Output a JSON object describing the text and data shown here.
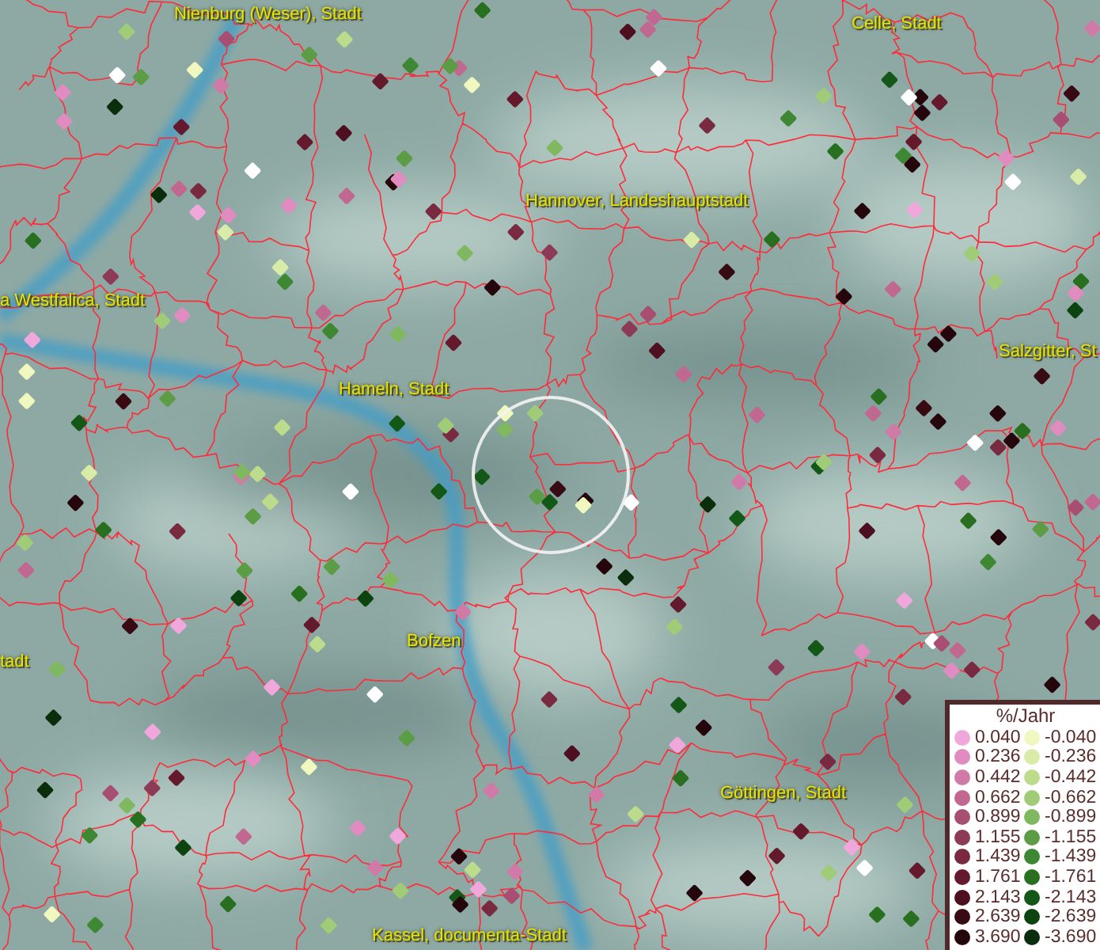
{
  "places": [
    {
      "name": "Nienburg (Weser), Stadt"
    },
    {
      "name": "Celle, Stadt"
    },
    {
      "name": "Hannover, Landeshauptstadt"
    },
    {
      "name": "a Westfalica, Stadt"
    },
    {
      "name": "Hameln, Stadt"
    },
    {
      "name": "Salzgitter, St"
    },
    {
      "name": "tadt"
    },
    {
      "name": "Bofzen"
    },
    {
      "name": "Göttingen, Stadt"
    },
    {
      "name": "Kassel, documenta-Stadt"
    }
  ],
  "legend": {
    "title": "%/Jahr",
    "positive": [
      {
        "label": "0.040",
        "color": "#f0a8dc"
      },
      {
        "label": "0.236",
        "color": "#e08cc0"
      },
      {
        "label": "0.442",
        "color": "#d07aa8"
      },
      {
        "label": "0.662",
        "color": "#c06890"
      },
      {
        "label": "0.899",
        "color": "#a84e72"
      },
      {
        "label": "1.155",
        "color": "#8c3a55"
      },
      {
        "label": "1.439",
        "color": "#7a2a40"
      },
      {
        "label": "1.761",
        "color": "#641a2c"
      },
      {
        "label": "2.143",
        "color": "#4e1020"
      },
      {
        "label": "2.639",
        "color": "#380a14"
      },
      {
        "label": "3.690",
        "color": "#24060c"
      }
    ],
    "negative": [
      {
        "label": "-0.040",
        "color": "#f0f8c0"
      },
      {
        "label": "-0.236",
        "color": "#d8eca8"
      },
      {
        "label": "-0.442",
        "color": "#bcdc8c"
      },
      {
        "label": "-0.662",
        "color": "#a0cc78"
      },
      {
        "label": "-0.899",
        "color": "#80b860"
      },
      {
        "label": "-1.155",
        "color": "#5c9c44"
      },
      {
        "label": "-1.439",
        "color": "#3e8834"
      },
      {
        "label": "-1.761",
        "color": "#287020"
      },
      {
        "label": "-2.143",
        "color": "#145818"
      },
      {
        "label": "-2.639",
        "color": "#0c4410"
      },
      {
        "label": "-3.690",
        "color": "#0a2e0c"
      }
    ]
  }
}
